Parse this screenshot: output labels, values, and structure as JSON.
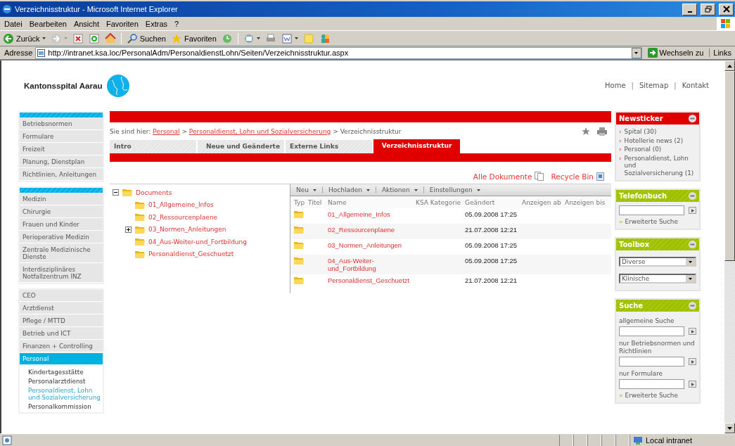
{
  "window": {
    "title": "Verzeichnisstruktur - Microsoft Internet Explorer"
  },
  "menu": [
    "Datei",
    "Bearbeiten",
    "Ansicht",
    "Favoriten",
    "Extras",
    "?"
  ],
  "toolbar": [
    {
      "kind": "back",
      "label": "Zurück"
    },
    {
      "kind": "forward"
    },
    {
      "kind": "stop"
    },
    {
      "kind": "refresh"
    },
    {
      "kind": "home"
    },
    {
      "kind": "sep"
    },
    {
      "kind": "search",
      "label": "Suchen"
    },
    {
      "kind": "favorites",
      "label": "Favoriten"
    },
    {
      "kind": "history"
    },
    {
      "kind": "sep"
    },
    {
      "kind": "mail"
    },
    {
      "kind": "print"
    },
    {
      "kind": "word"
    },
    {
      "kind": "note"
    },
    {
      "kind": "messenger"
    }
  ],
  "address": {
    "label": "Adresse",
    "url": "http://intranet.ksa.loc/PersonalAdm/PersonaldienstLohn/Seiten/Verzeichnisstruktur.aspx",
    "go": "Wechseln zu",
    "links": "Links"
  },
  "site": {
    "logo": "Kantonsspital Aarau",
    "top_links": [
      "Home",
      "Sitemap",
      "Kontakt"
    ],
    "separator": "|"
  },
  "nav": [
    {
      "striped": true,
      "items": [
        {
          "label": "Betriebsnormen",
          "selected": false
        },
        {
          "label": "Formulare",
          "selected": false
        },
        {
          "label": "Freizeit",
          "selected": false
        },
        {
          "label": "Planung, Dienstplan",
          "selected": false
        },
        {
          "label": "Richtlinien, Anleitungen",
          "selected": false
        }
      ]
    },
    {
      "striped": true,
      "items": [
        {
          "label": "Medizin",
          "selected": false
        },
        {
          "label": "Chirurgie",
          "selected": false
        },
        {
          "label": "Frauen und Kinder",
          "selected": false
        },
        {
          "label": "Perioperative Medizin",
          "selected": false
        },
        {
          "label": "Zentrale Medizinische Dienste",
          "selected": false
        },
        {
          "label": "Interdisziplinäres Notfallzentrum INZ",
          "selected": false
        }
      ]
    },
    {
      "striped": false,
      "items": [
        {
          "label": "CEO",
          "selected": false
        },
        {
          "label": "Arztdienst",
          "selected": false
        },
        {
          "label": "Pflege / MTTD",
          "selected": false
        },
        {
          "label": "Betrieb und ICT",
          "selected": false
        },
        {
          "label": "Finanzen + Controlling",
          "selected": false
        },
        {
          "label": "Personal",
          "selected": true,
          "children": [
            {
              "label": "Kindertagesstätte",
              "selected": false
            },
            {
              "label": "Personalarztdienst",
              "selected": false
            },
            {
              "label": "Personaldienst, Lohn und Sozialversicherung",
              "selected": true
            },
            {
              "label": "Personalkommission",
              "selected": false
            }
          ]
        }
      ]
    }
  ],
  "breadcrumb": {
    "prefix": "Sie sind hier:",
    "separator": ">",
    "items": [
      {
        "label": "Personal",
        "link": true
      },
      {
        "label": "Personaldienst, Lohn und Sozialversicherung",
        "link": true
      },
      {
        "label": "Verzeichnisstruktur",
        "link": false
      }
    ]
  },
  "tabs": [
    {
      "label": "Intro",
      "selected": false
    },
    {
      "label": "Neue und Geänderte",
      "selected": false
    },
    {
      "label": "Externe Links",
      "selected": false
    },
    {
      "label": "Verzeichnisstruktur",
      "selected": true
    }
  ],
  "doc_links": [
    {
      "kind": "documents",
      "label": "Alle Dokumente"
    },
    {
      "kind": "recycle",
      "label": "Recycle Bin"
    }
  ],
  "tree": {
    "label": "Documents",
    "expanded": true,
    "children": [
      {
        "label": "01_Allgemeine_Infos",
        "expandable": false
      },
      {
        "label": "02_Ressourcenplaene",
        "expandable": false
      },
      {
        "label": "03_Normen_Anleitungen",
        "expandable": true
      },
      {
        "label": "04_Aus-Weiter-und_Fortbildung",
        "expandable": false
      },
      {
        "label": "Personaldienst_Geschuetzt",
        "expandable": false
      }
    ]
  },
  "list_menu": [
    "Neu",
    "Hochladen",
    "Aktionen",
    "Einstellungen"
  ],
  "table": {
    "columns": [
      "Typ",
      "Titel",
      "Name",
      "KSA Kategorie",
      "Geändert",
      "Anzeigen ab",
      "Anzeigen bis"
    ],
    "rows": [
      {
        "name": "01_Allgemeine_Infos",
        "changed": "05.09.2008 17:25"
      },
      {
        "name": "02_Ressourcenplaene",
        "changed": "21.07.2008 12:21"
      },
      {
        "name": "03_Normen_Anleitungen",
        "changed": "05.09.2008 17:25"
      },
      {
        "name": "04_Aus-Weiter-und_Fortbildung",
        "changed": "05.09.2008 17:25"
      },
      {
        "name": "Personaldienst_Geschuetzt",
        "changed": "21.07.2008 12:21"
      }
    ]
  },
  "newsticker": {
    "title": "Newsticker",
    "bullet": "›",
    "items": [
      "Spital (30)",
      "Hotellerie news (2)",
      "Personal (0)",
      "Personaldienst, Lohn und Sozialversicherung (1)"
    ]
  },
  "telefonbuch": {
    "title": "Telefonbuch",
    "more_marker": "»",
    "more": "Erweiterte Suche"
  },
  "toolbox": {
    "title": "Toolbox",
    "selects": [
      "Diverse",
      "Klinische"
    ]
  },
  "suche": {
    "title": "Suche",
    "fields": [
      "allgemeine Suche",
      "nur Betriebsnormen und Richtlinien",
      "nur Formulare"
    ],
    "more_marker": "»",
    "more": "Erweiterte Suche"
  },
  "status_bar": {
    "zone": "Local intranet"
  }
}
